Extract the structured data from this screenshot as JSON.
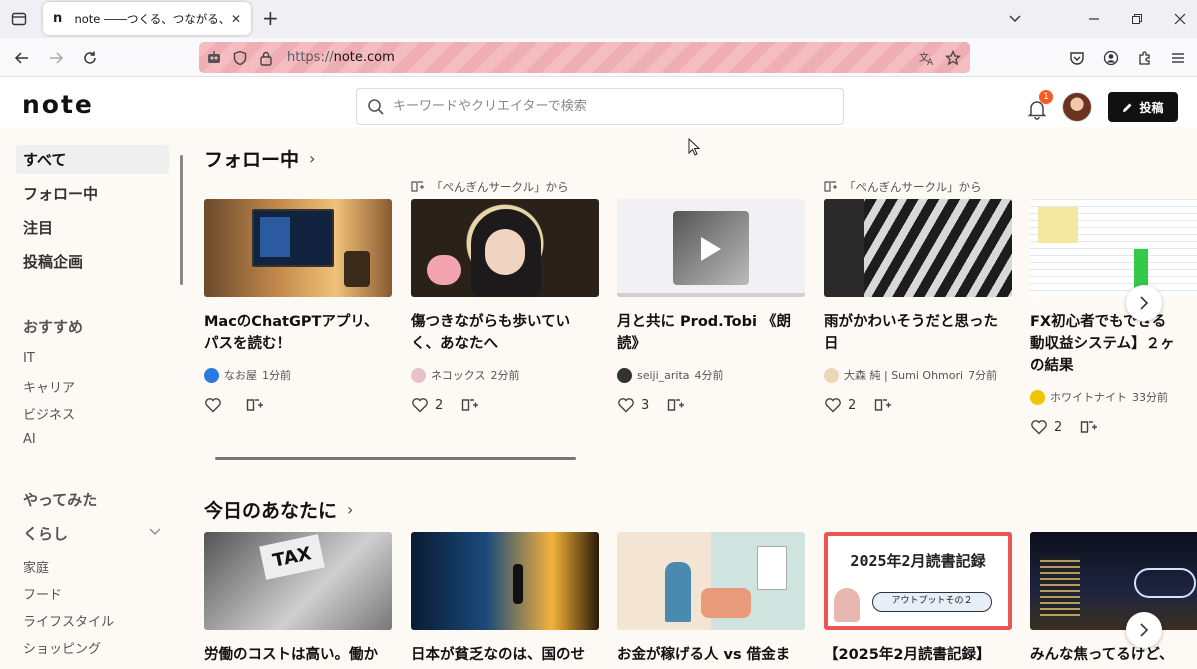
{
  "browser": {
    "tab_title": "note ――つくる、つながる、とどける。",
    "tab_favicon": "n",
    "url_scheme": "https://",
    "url_host": "note.com"
  },
  "header": {
    "logo": "note",
    "search_placeholder": "キーワードやクリエイターで検索",
    "notification_count": "1",
    "post_label": "投稿"
  },
  "sidebar": {
    "primary": [
      {
        "label": "すべて",
        "active": true
      },
      {
        "label": "フォロー中"
      },
      {
        "label": "注目"
      },
      {
        "label": "投稿企画"
      }
    ],
    "recommend_head": "おすすめ",
    "recommend": [
      "IT",
      "キャリア",
      "ビジネス",
      "AI"
    ],
    "tried_head": "やってみた",
    "life_head": "くらし",
    "life": [
      "家庭",
      "フード",
      "ライフスタイル",
      "ショッピング"
    ]
  },
  "sections": [
    {
      "title": "フォロー中",
      "cards": [
        {
          "title": "MacのChatGPTアプリ、\nパスを読む！",
          "author": "なお屋",
          "time": "1分前",
          "likes": "",
          "magazine": ""
        },
        {
          "title": "傷つきながらも歩いてい\nく、あなたへ",
          "author": "ネコックス",
          "time": "2分前",
          "likes": "2",
          "magazine": "「ぺんぎんサークル」から"
        },
        {
          "title": "月と共に Prod.Tobi 《朗\n読》",
          "author": "seiji_arita",
          "time": "4分前",
          "likes": "3",
          "magazine": ""
        },
        {
          "title": "雨がかわいそうだと思った\n日",
          "author": "大森 純 | Sumi Ohmori",
          "time": "7分前",
          "likes": "2",
          "magazine": "「ぺんぎんサークル」から"
        },
        {
          "title": "FX初心者でもできる\n動収益システム】２ヶ\nの結果",
          "author": "ホワイトナイト",
          "time": "33分前",
          "likes": "2",
          "magazine": ""
        }
      ]
    },
    {
      "title": "今日のあなたに",
      "cards": [
        {
          "title": "労働のコストは高い。働か"
        },
        {
          "title": "日本が貧乏なのは、国のせ"
        },
        {
          "title": "お金が稼げる人 vs 借金ま"
        },
        {
          "title": "【2025年2月読書記録】"
        },
        {
          "title": "みんな焦ってるけど、"
        }
      ]
    }
  ],
  "thumb_text": {
    "tax": "TAX",
    "book_title": "2025年2月読書記録",
    "book_sub": "アウトプットその２"
  },
  "colors": {
    "brand": "#111111",
    "badge": "#ff5722",
    "main_bg": "#fdfaf5"
  }
}
